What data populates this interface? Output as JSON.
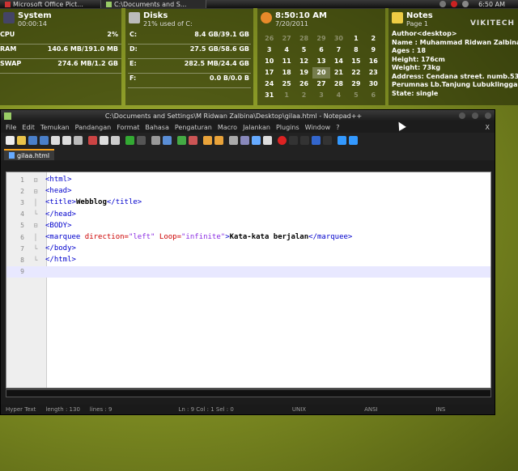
{
  "taskbar": {
    "tasks": [
      "Microsoft Office Pict...",
      "C:\\Documents and S..."
    ],
    "clock": "6:50 AM"
  },
  "system": {
    "title": "System",
    "uptime": "00:00:14",
    "rows": [
      {
        "label": "CPU",
        "value": "2%"
      },
      {
        "label": "RAM",
        "value": "140.6 MB/191.0 MB"
      },
      {
        "label": "SWAP",
        "value": "274.6 MB/1.2 GB"
      }
    ]
  },
  "disks": {
    "title": "Disks",
    "subtitle": "21% used of C:",
    "rows": [
      {
        "label": "C:",
        "value": "8.4 GB/39.1 GB"
      },
      {
        "label": "D:",
        "value": "27.5 GB/58.6 GB"
      },
      {
        "label": "E:",
        "value": "282.5 MB/24.4 GB"
      },
      {
        "label": "F:",
        "value": "0.0 B/0.0 B"
      }
    ]
  },
  "calendar": {
    "time": "8:50:10 AM",
    "date": "7/20/2011",
    "days": [
      {
        "d": "26",
        "dim": true
      },
      {
        "d": "27",
        "dim": true
      },
      {
        "d": "28",
        "dim": true
      },
      {
        "d": "29",
        "dim": true
      },
      {
        "d": "30",
        "dim": true
      },
      {
        "d": "1",
        "dim": false
      },
      {
        "d": "2",
        "dim": false
      },
      {
        "d": "3",
        "dim": false
      },
      {
        "d": "4",
        "dim": false
      },
      {
        "d": "5",
        "dim": false
      },
      {
        "d": "6",
        "dim": false
      },
      {
        "d": "7",
        "dim": false
      },
      {
        "d": "8",
        "dim": false
      },
      {
        "d": "9",
        "dim": false
      },
      {
        "d": "10",
        "dim": false
      },
      {
        "d": "11",
        "dim": false
      },
      {
        "d": "12",
        "dim": false
      },
      {
        "d": "13",
        "dim": false
      },
      {
        "d": "14",
        "dim": false
      },
      {
        "d": "15",
        "dim": false
      },
      {
        "d": "16",
        "dim": false
      },
      {
        "d": "17",
        "dim": false
      },
      {
        "d": "18",
        "dim": false
      },
      {
        "d": "19",
        "dim": false
      },
      {
        "d": "20",
        "dim": false,
        "today": true
      },
      {
        "d": "21",
        "dim": false
      },
      {
        "d": "22",
        "dim": false
      },
      {
        "d": "23",
        "dim": false
      },
      {
        "d": "24",
        "dim": false
      },
      {
        "d": "25",
        "dim": false
      },
      {
        "d": "26",
        "dim": false
      },
      {
        "d": "27",
        "dim": false
      },
      {
        "d": "28",
        "dim": false
      },
      {
        "d": "29",
        "dim": false
      },
      {
        "d": "30",
        "dim": false
      },
      {
        "d": "31",
        "dim": false
      },
      {
        "d": "1",
        "dim": true
      },
      {
        "d": "2",
        "dim": true
      },
      {
        "d": "3",
        "dim": true
      },
      {
        "d": "4",
        "dim": true
      },
      {
        "d": "5",
        "dim": true
      },
      {
        "d": "6",
        "dim": true
      }
    ]
  },
  "notes": {
    "title": "Notes",
    "page": "Page 1",
    "logo": "VIKITECH",
    "lines": [
      "Author<desktop>",
      "Name : Muhammad Ridwan Zalbina",
      "Ages : 18",
      "Height: 176cm",
      "Weight: 73kg",
      "Address: Cendana street. numb.53",
      "Perumnas Lb.Tanjung Lubuklinggau",
      "State: single"
    ]
  },
  "notepad": {
    "title": "C:\\Documents and Settings\\M Ridwan Zalbina\\Desktop\\gilaa.html - Notepad++",
    "menu": [
      "File",
      "Edit",
      "Temukan",
      "Pandangan",
      "Format",
      "Bahasa",
      "Pengaturan",
      "Macro",
      "Jalankan",
      "Plugins",
      "Window",
      "?"
    ],
    "close_x": "X",
    "tab": "gilaa.html",
    "code": [
      {
        "n": "1",
        "fold": "⊟",
        "parts": [
          {
            "t": "<html>",
            "c": "tag"
          }
        ]
      },
      {
        "n": "2",
        "fold": "⊟",
        "parts": [
          {
            "t": "<head>",
            "c": "tag"
          }
        ]
      },
      {
        "n": "3",
        "fold": "│",
        "parts": [
          {
            "t": "<title>",
            "c": "tag"
          },
          {
            "t": "Webblog",
            "c": "bold"
          },
          {
            "t": "</title>",
            "c": "tag"
          }
        ]
      },
      {
        "n": "4",
        "fold": "└",
        "parts": [
          {
            "t": "</head>",
            "c": "tag"
          }
        ]
      },
      {
        "n": "5",
        "fold": "⊟",
        "parts": [
          {
            "t": "<BODY>",
            "c": "tag"
          }
        ]
      },
      {
        "n": "6",
        "fold": "│",
        "parts": [
          {
            "t": "<marquee ",
            "c": "tag"
          },
          {
            "t": "direction=",
            "c": "attr"
          },
          {
            "t": "\"left\" ",
            "c": "str"
          },
          {
            "t": "Loop=",
            "c": "attr"
          },
          {
            "t": "\"infinite\"",
            "c": "str"
          },
          {
            "t": ">",
            "c": "tag"
          },
          {
            "t": "Kata-kata berjalan",
            "c": "bold"
          },
          {
            "t": "</marquee>",
            "c": "tag"
          }
        ]
      },
      {
        "n": "7",
        "fold": "└",
        "parts": [
          {
            "t": "</body>",
            "c": "tag"
          }
        ]
      },
      {
        "n": "8",
        "fold": "└",
        "parts": [
          {
            "t": "</html>",
            "c": "tag"
          }
        ]
      },
      {
        "n": "9",
        "fold": "",
        "parts": [
          {
            "t": "",
            "c": "tag"
          }
        ]
      }
    ],
    "status": {
      "type": "Hyper Text",
      "length": "length : 130",
      "lines": "lines : 9",
      "pos": "Ln : 9    Col : 1    Sel : 0",
      "eol": "UNIX",
      "enc": "ANSI",
      "mode": "INS"
    }
  },
  "colors": {
    "accent": "#f7a21b",
    "tag": "#0000cc",
    "attr": "#cc0000",
    "string": "#8a2be2"
  }
}
